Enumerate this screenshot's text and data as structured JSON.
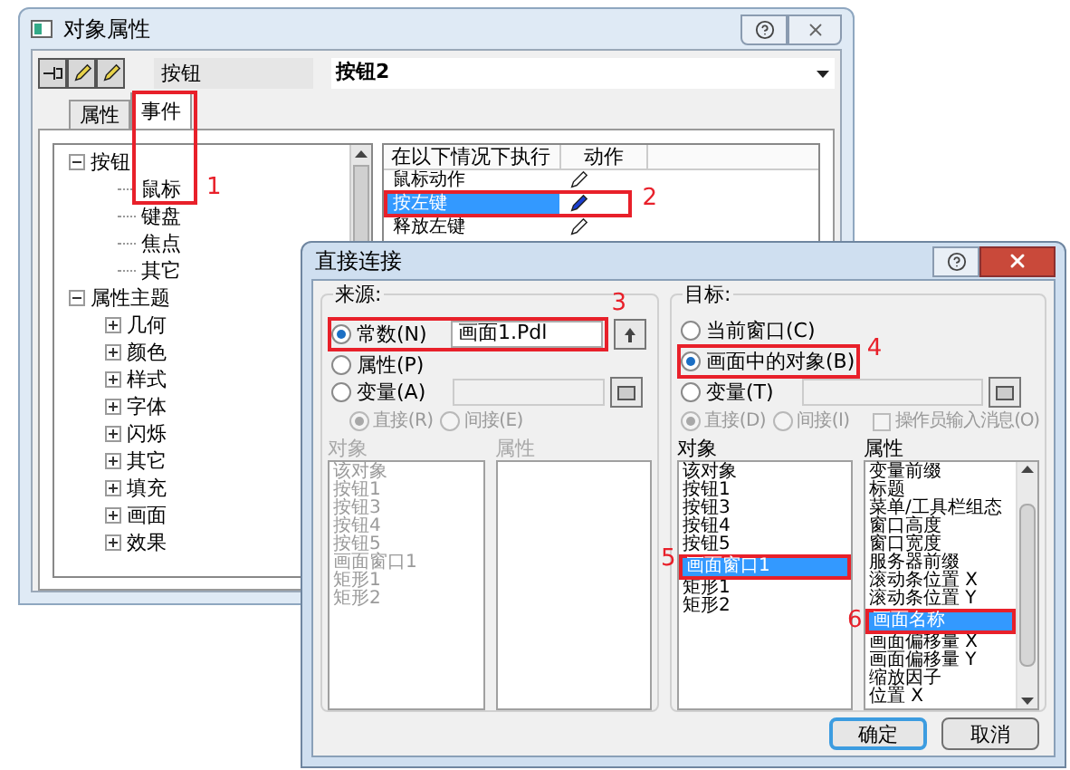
{
  "background_window": {
    "title": "对象属性",
    "object_type": "按钮",
    "object_name": "按钮2",
    "tabs": [
      {
        "label": "属性",
        "selected": false
      },
      {
        "label": "事件",
        "selected": true
      }
    ],
    "tree": [
      {
        "label": "按钮",
        "expanded": true,
        "children": [
          {
            "label": "鼠标"
          },
          {
            "label": "键盘"
          },
          {
            "label": "焦点"
          },
          {
            "label": "其它"
          }
        ]
      },
      {
        "label": "属性主题",
        "expanded": true,
        "children": [
          {
            "label": "几何",
            "expanded": false
          },
          {
            "label": "颜色",
            "expanded": false
          },
          {
            "label": "样式",
            "expanded": false
          },
          {
            "label": "字体",
            "expanded": false
          },
          {
            "label": "闪烁",
            "expanded": false
          },
          {
            "label": "其它",
            "expanded": false
          },
          {
            "label": "填充",
            "expanded": false
          },
          {
            "label": "画面",
            "expanded": false
          },
          {
            "label": "效果",
            "expanded": false
          }
        ]
      }
    ],
    "events_table": {
      "columns": [
        "在以下情况下执行",
        "动作"
      ],
      "rows": [
        {
          "label": "鼠标动作",
          "selected": false
        },
        {
          "label": "按左键",
          "selected": true
        },
        {
          "label": "释放左键",
          "selected": false
        }
      ]
    }
  },
  "front_window": {
    "title": "直接连接",
    "source": {
      "label": "来源:",
      "options": [
        {
          "label": "常数(N)",
          "selected": true,
          "kind": "text",
          "value": "画面1.Pdl"
        },
        {
          "label": "属性(P)",
          "selected": false,
          "kind": "none"
        },
        {
          "label": "变量(A)",
          "selected": false,
          "kind": "variable"
        }
      ],
      "modes": [
        {
          "label": "直接(R)",
          "selected": true,
          "disabled": true
        },
        {
          "label": "间接(E)",
          "selected": false,
          "disabled": true
        }
      ],
      "lists": [
        {
          "label": "对象",
          "disabled": true,
          "items": [
            {
              "label": "该对象",
              "selected": false
            },
            {
              "label": "按钮1",
              "selected": false
            },
            {
              "label": "按钮3",
              "selected": false
            },
            {
              "label": "按钮4",
              "selected": false
            },
            {
              "label": "按钮5",
              "selected": false
            },
            {
              "label": "画面窗口1",
              "selected": false
            },
            {
              "label": "矩形1",
              "selected": false
            },
            {
              "label": "矩形2",
              "selected": false
            }
          ]
        },
        {
          "label": "属性",
          "disabled": true
        }
      ]
    },
    "target": {
      "label": "目标:",
      "options": [
        {
          "label": "当前窗口(C)",
          "selected": false,
          "kind": "none"
        },
        {
          "label": "画面中的对象(B)",
          "selected": true,
          "kind": "none"
        },
        {
          "label": "变量(T)",
          "selected": false,
          "kind": "variable"
        }
      ],
      "modes": [
        {
          "label": "直接(D)",
          "selected": true,
          "disabled": true
        },
        {
          "label": "间接(I)",
          "selected": false,
          "disabled": true
        }
      ],
      "checkbox": {
        "label": "操作员输入消息(O)",
        "checked": false,
        "disabled": true
      },
      "lists": [
        {
          "label": "对象",
          "disabled": false,
          "items": [
            {
              "label": "该对象",
              "selected": false
            },
            {
              "label": "按钮1",
              "selected": false
            },
            {
              "label": "按钮3",
              "selected": false
            },
            {
              "label": "按钮4",
              "selected": false
            },
            {
              "label": "按钮5",
              "selected": false
            },
            {
              "label": "画面窗口1",
              "selected": true
            },
            {
              "label": "矩形1",
              "selected": false
            },
            {
              "label": "矩形2",
              "selected": false
            }
          ]
        },
        {
          "label": "属性",
          "disabled": false,
          "items": [
            {
              "label": "变量前缀",
              "selected": false
            },
            {
              "label": "标题",
              "selected": false
            },
            {
              "label": "菜单/工具栏组态",
              "selected": false
            },
            {
              "label": "窗口高度",
              "selected": false
            },
            {
              "label": "窗口宽度",
              "selected": false
            },
            {
              "label": "服务器前缀",
              "selected": false
            },
            {
              "label": "滚动条位置 X",
              "selected": false
            },
            {
              "label": "滚动条位置 Y",
              "selected": false
            },
            {
              "label": "画面名称",
              "selected": true
            },
            {
              "label": "画面偏移量 X",
              "selected": false
            },
            {
              "label": "画面偏移量 Y",
              "selected": false
            },
            {
              "label": "缩放因子",
              "selected": false
            },
            {
              "label": "位置 X",
              "selected": false
            }
          ]
        }
      ]
    },
    "buttons": [
      {
        "label": "确定",
        "default": true
      },
      {
        "label": "取消",
        "default": false
      }
    ]
  },
  "annotations": [
    {
      "label": "1"
    },
    {
      "label": "2"
    },
    {
      "label": "3"
    },
    {
      "label": "4"
    },
    {
      "label": "5"
    },
    {
      "label": "6"
    }
  ]
}
